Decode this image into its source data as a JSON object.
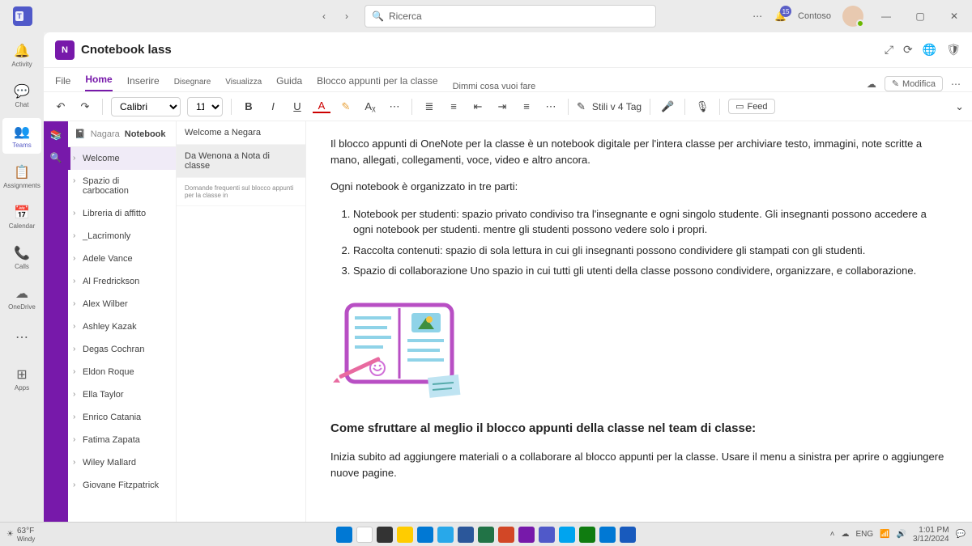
{
  "titlebar": {
    "search_placeholder": "Ricerca",
    "org_name": "Contoso",
    "notification_count": "15",
    "window_buttons": {
      "min": "—",
      "max": "▢",
      "close": "✕"
    }
  },
  "rail": {
    "items": [
      {
        "icon": "🔔",
        "label": "Activity"
      },
      {
        "icon": "💬",
        "label": "Chat"
      },
      {
        "icon": "👥",
        "label": "Teams"
      },
      {
        "icon": "📋",
        "label": "Assignments"
      },
      {
        "icon": "📅",
        "label": "Calendar"
      },
      {
        "icon": "📞",
        "label": "Calls"
      },
      {
        "icon": "☁",
        "label": "OneDrive"
      },
      {
        "icon": "⋯",
        "label": ""
      },
      {
        "icon": "⊞",
        "label": "Apps"
      }
    ],
    "selected_index": 2
  },
  "app": {
    "icon_text": "N",
    "name": "Cnotebook lass",
    "header_icons": [
      "⤢",
      "⟳",
      "🌐",
      "🛡"
    ]
  },
  "ribbon": {
    "tabs": [
      "File",
      "Home",
      "Inserire",
      "Disegnare",
      "Visualizza",
      "Guida",
      "Blocco appunti per la classe"
    ],
    "selected_index": 1,
    "tell_me": "Dimmi cosa vuoi fare",
    "cloud_icon": "☁",
    "edit_label": "Modifica",
    "more": "⋯"
  },
  "toolbar": {
    "undo": "↶",
    "redo": "↷",
    "font": "Calibri",
    "size": "11",
    "bold": "B",
    "italic": "I",
    "underline": "U",
    "fontcolor": "A",
    "highlight": "✎",
    "clear": "Aᵪ",
    "bullets": "≣",
    "numbers": "≡",
    "indentL": "⇤",
    "indentR": "⇥",
    "align": "≡",
    "more1": "⋯",
    "styles": "Stili v 4 Tag",
    "styles_icon": "✎",
    "dictate": "🎤",
    "mic": "🎙",
    "feed_label": "Feed",
    "feed_icon": "▭",
    "chev": "⌄"
  },
  "purplebar": {
    "items": [
      "📚",
      "🔍"
    ]
  },
  "breadcrumb": {
    "icon": "📓",
    "path": "Nagara",
    "current": "Notebook"
  },
  "nav1": {
    "items": [
      "Welcome",
      "Spazio di carbocation",
      "Libreria di affitto",
      "_Lacrimonly",
      "Adele Vance",
      "Al Fredrickson",
      "Alex Wilber",
      "Ashley Kazak",
      "Degas Cochran",
      "Eldon Roque",
      "Ella Taylor",
      "Enrico Catania",
      "Fatima Zapata",
      "Wiley Mallard",
      "Giovane Fitzpatrick"
    ],
    "selected_index": 0
  },
  "nav2": {
    "items": [
      {
        "label": "Welcome a Negara"
      },
      {
        "label": "Da Wenona a Nota di classe",
        "selected": true
      },
      {
        "label": "Domande frequenti sul blocco appunti per la classe in",
        "tiny": true
      }
    ]
  },
  "content": {
    "intro": "Il blocco appunti di OneNote per la classe è un notebook digitale per l'intera classe per archiviare testo, immagini, note scritte a mano, allegati, collegamenti, voce, video e altro ancora.",
    "org_line": "Ogni notebook è organizzato in tre parti:",
    "list": [
      "Notebook per studenti: spazio privato condiviso tra l'insegnante e ogni singolo studente. Gli insegnanti possono accedere a ogni notebook per studenti. mentre gli studenti possono vedere solo i propri.",
      "Raccolta contenuti: spazio di sola lettura in cui gli insegnanti possono condividere gli stampati con gli studenti.",
      "Spazio di collaborazione   Uno spazio in cui tutti gli utenti della classe possono condividere, organizzare, e collaborazione."
    ],
    "heading2": "Come sfruttare al meglio il blocco appunti della classe nel team di classe:",
    "para2": "Inizia subito ad aggiungere materiali o a collaborare al blocco appunti per la classe. Usare il menu a sinistra per aprire o aggiungere nuove pagine."
  },
  "taskbar": {
    "weather": "63°F",
    "weather2": "Windy",
    "tray": {
      "lang": "ENG",
      "net": "📶",
      "vol": "🔊",
      "time": "1:01 PM",
      "date": "3/12/2024"
    }
  }
}
